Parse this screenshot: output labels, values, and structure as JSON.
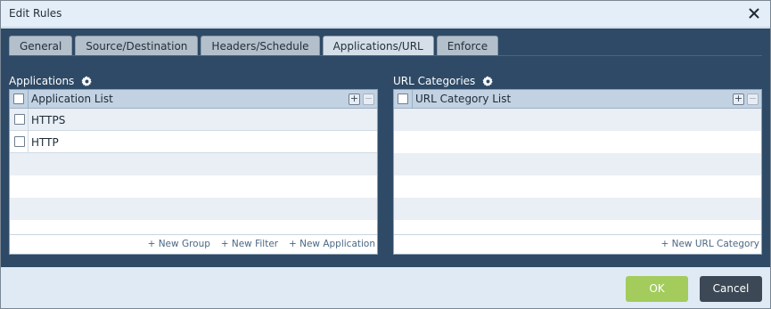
{
  "dialog": {
    "title": "Edit Rules",
    "ok_label": "OK",
    "cancel_label": "Cancel"
  },
  "tabs": [
    {
      "label": "General",
      "active": false
    },
    {
      "label": "Source/Destination",
      "active": false
    },
    {
      "label": "Headers/Schedule",
      "active": false
    },
    {
      "label": "Applications/URL",
      "active": true
    },
    {
      "label": "Enforce",
      "active": false
    }
  ],
  "applications": {
    "section_title": "Applications",
    "column_header": "Application List",
    "rows": [
      {
        "name": "HTTPS",
        "checked": false
      },
      {
        "name": "HTTP",
        "checked": false
      }
    ],
    "footer_links": [
      "+ New Group",
      "+ New Filter",
      "+ New Application"
    ]
  },
  "url_categories": {
    "section_title": "URL Categories",
    "column_header": "URL Category List",
    "rows": [],
    "footer_links": [
      "+ New URL Category"
    ]
  },
  "icons": {
    "close": "close-icon",
    "settings": "gear-icon",
    "add": "plus-icon",
    "remove": "minus-icon"
  },
  "colors": {
    "panel_bg": "#2e4a66",
    "dialog_bg": "#dfeaf5",
    "ok_button": "#a3cc5c",
    "cancel_button": "#3c4856",
    "grid_header": "#c2d2e2"
  }
}
